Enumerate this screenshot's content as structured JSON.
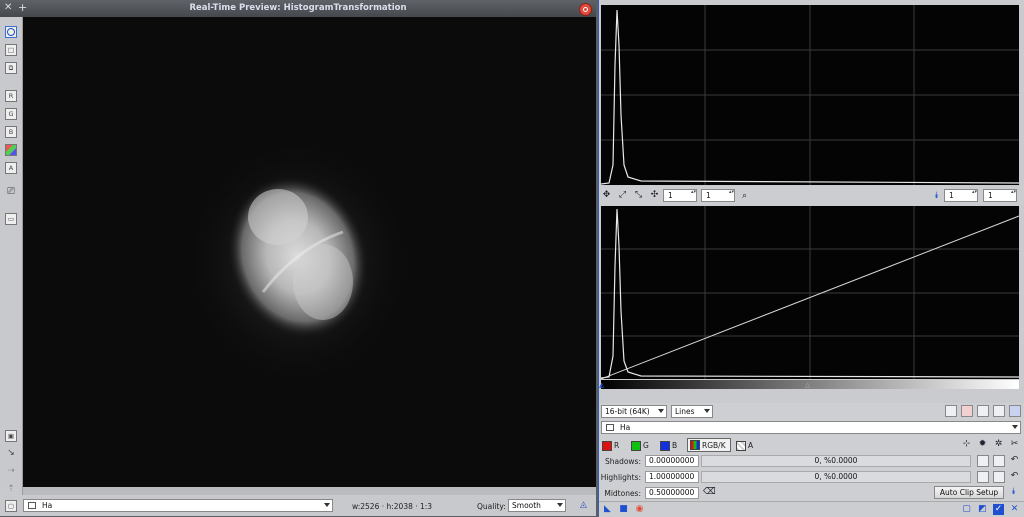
{
  "preview_window": {
    "title": "Real-Time Preview: HistogramTransformation",
    "toolbar_letters": [
      "R",
      "G",
      "B",
      "A"
    ],
    "status": {
      "view_name": "Ha",
      "dimensions": "w:2526 · h:2038 · 1:3",
      "quality_label": "Quality:",
      "quality_value": "Smooth"
    }
  },
  "histogram_window": {
    "upper_zoom_h": "1",
    "upper_zoom_v": "1",
    "lower_zoom_h": "1",
    "lower_zoom_v": "1",
    "resolution": "16-bit (64K)",
    "graph_style": "Lines",
    "target_view": "Ha",
    "channels": {
      "r": "R",
      "g": "G",
      "b": "B",
      "rgbk": "RGB/K",
      "a": "A"
    },
    "shadows": {
      "label": "Shadows:",
      "value": "0.00000000",
      "clip": "0, %0.0000"
    },
    "highlights": {
      "label": "Highlights:",
      "value": "1.00000000",
      "clip": "0, %0.0000"
    },
    "midtones": {
      "label": "Midtones:",
      "value": "0.50000000"
    },
    "auto_clip_button": "Auto Clip Setup"
  },
  "colors": {
    "accent": "#3b5fb0",
    "close": "#e34a3c",
    "red": "#e01010",
    "green": "#10c010",
    "blue": "#1030e0"
  }
}
